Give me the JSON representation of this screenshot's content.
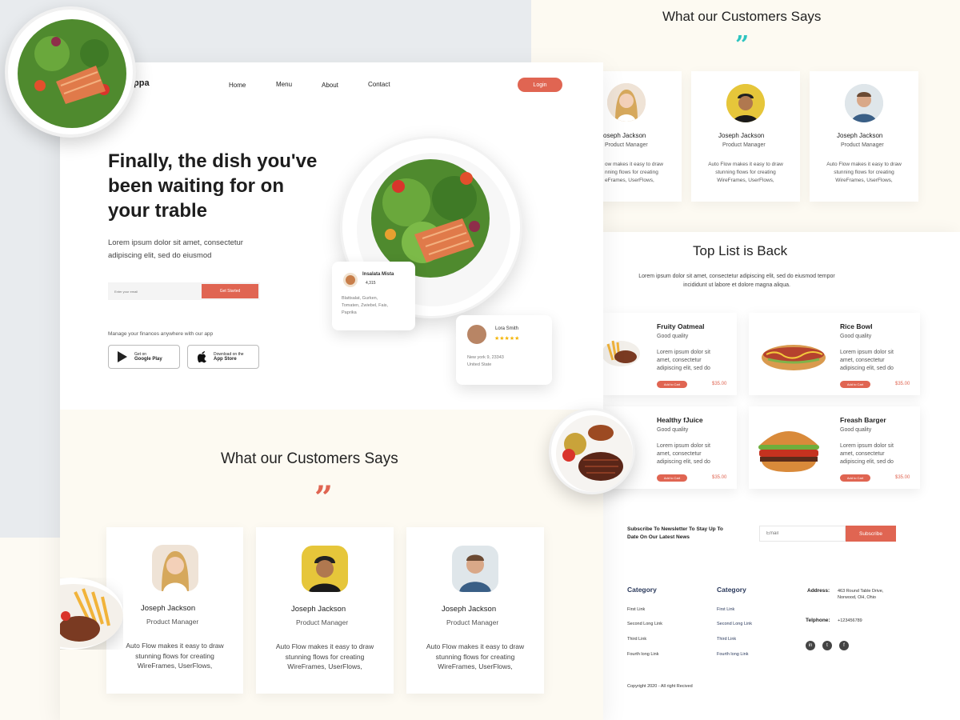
{
  "brand": {
    "logo_text": "ppa"
  },
  "nav": {
    "home": "Home",
    "menu": "Menu",
    "about": "About",
    "contact": "Contact",
    "login": "Login"
  },
  "hero": {
    "title": "Finally, the dish you've been waiting for on your trable",
    "subtitle": "Lorem ipsum dolor sit amet, consectetur adipiscing elit, sed do eiusmod",
    "email_placeholder": "Enter your email",
    "cta": "Get Started",
    "manage_text": "Manage your finances anywhere with our app",
    "google_top": "Get on",
    "google_bottom": "Google Play",
    "apple_top": "Download on the",
    "apple_bottom": "App Store"
  },
  "dish_card": {
    "name": "Insalata Mista",
    "count": "4,315",
    "ingredients": "Blattsalat, Gurken, Tomaten, Zwiebel, Fais, Paprika"
  },
  "review_card": {
    "name": "Lora Smith",
    "stars": "★★★★★",
    "address": "New york 9, 23343",
    "country": "United State"
  },
  "testimonials": {
    "title": "What our Customers Says",
    "quote_mark": "”",
    "items": [
      {
        "name": "Joseph Jackson",
        "role": "Product Manager",
        "text": "Auto Flow makes it easy to draw stunning flows for creating WireFrames, UserFlows,"
      },
      {
        "name": "Joseph Jackson",
        "role": "Product Manager",
        "text": "Auto Flow makes it easy to draw stunning flows for creating WireFrames, UserFlows,"
      },
      {
        "name": "Joseph Jackson",
        "role": "Product Manager",
        "text": "Auto Flow makes it easy to draw stunning flows for creating WireFrames, UserFlows,"
      }
    ],
    "right_items": [
      {
        "name": "oseph Jackson",
        "role": "Product Manager",
        "text": "ow makes it easy to draw nning flows for creating eFrames, UserFlows,"
      },
      {
        "name": "Joseph Jackson",
        "role": "Product Manager",
        "text": "Auto Flow makes it easy to draw stunning flows for creating WireFrames, UserFlows,"
      },
      {
        "name": "Joseph Jackson",
        "role": "Product Manager",
        "text": "Auto Flow makes it easy to draw stunning flows for creating WireFrames, UserFlows,"
      }
    ]
  },
  "top_list": {
    "title": "Top List is Back",
    "subtitle": "Lorem ipsum dolor sit amet, consectetur adipiscing elit, sed do eiusmod tempor incididunt ut labore et dolore magna aliqua.",
    "items": [
      {
        "name": "Fruity Oatmeal",
        "quality": "Good quality",
        "desc": "Lorem ipsum dolor sit amet, consectetur adipiscing elit, sed do",
        "button": "Add to Cart",
        "price": "$35.00"
      },
      {
        "name": "Rice Bowl",
        "quality": "Good quality",
        "desc": "Lorem ipsum dolor sit amet, consectetur adipiscing elit, sed do",
        "button": "Add to Cart",
        "price": "$35.00"
      },
      {
        "name": "Healthy fJuice",
        "quality": "Good quality",
        "desc": "Lorem ipsum dolor sit amet, consectetur adipiscing elit, sed do",
        "button": "Add to Cart",
        "price": "$35.00"
      },
      {
        "name": "Freash Barger",
        "quality": "Good quality",
        "desc": "Lorem ipsum dolor sit amet, consectetur adipiscing elit, sed do",
        "button": "Add to Cart",
        "price": "$35.00"
      }
    ]
  },
  "newsletter": {
    "text": "Subscribe To Newsletter To Stay Up To Date On Our Latest News",
    "placeholder": "Email",
    "button": "Subscribe"
  },
  "footer": {
    "col1": {
      "title": "Category",
      "links": [
        "First Link",
        "Second Long Link",
        "Third Link",
        "Fourth long Link"
      ]
    },
    "col2": {
      "title": "Category",
      "links": [
        "First Link",
        "Second Long Link",
        "Third Link",
        "Fourth long Link"
      ]
    },
    "address_label": "Address:",
    "address": "463 Round Table Drive, Norwood, OH, Ohio",
    "phone_label": "Telphone:",
    "phone": "+123456789",
    "social": [
      "in",
      "t",
      "f"
    ],
    "copyright": "Copyright 2020 - All right Recived"
  },
  "colors": {
    "accent": "#e06552",
    "teal": "#2ec4c0",
    "navy": "#2b3a5c"
  }
}
